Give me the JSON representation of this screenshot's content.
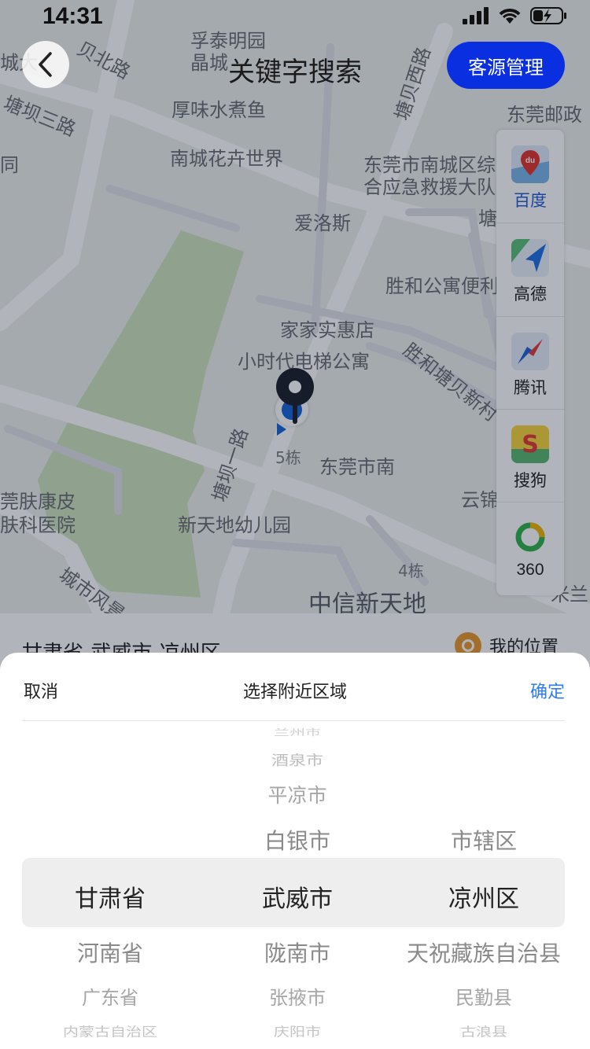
{
  "status_bar": {
    "time": "14:31"
  },
  "header": {
    "title": "关键字搜索",
    "source_button": "客源管理"
  },
  "map": {
    "labels": [
      "孚泰明园",
      "晶城",
      "城大",
      "贝北路",
      "塘贝西路",
      "塘坝三路",
      "厚味水煮鱼",
      "东莞邮政",
      "南城花卉世界",
      "东莞市南城区综",
      "合应急救援大队",
      "爱洛斯",
      "塘",
      "胜和公寓便利",
      "家家实惠店",
      "小时代电梯公寓",
      "胜和塘贝新村",
      "塘坝一路",
      "5栋",
      "东莞市南",
      "云锦",
      "莞肤康皮",
      "肤科医院",
      "新天地幼儿园",
      "城市风景",
      "4栋",
      "中信新天地",
      "米兰",
      "同"
    ]
  },
  "providers": [
    {
      "label": "百度",
      "icon": "baidu-map-icon",
      "active": true
    },
    {
      "label": "高德",
      "icon": "amap-icon"
    },
    {
      "label": "腾讯",
      "icon": "tencent-map-icon"
    },
    {
      "label": "搜狗",
      "icon": "sogou-map-icon"
    },
    {
      "label": "360",
      "icon": "360-map-icon"
    }
  ],
  "info_bar": {
    "region": "甘肃省-武威市-凉州区",
    "my_location": "我的位置"
  },
  "sheet": {
    "cancel": "取消",
    "title": "选择附近区域",
    "confirm": "确定",
    "accent": "#2f7bf2",
    "province": [
      "甘肃省",
      "河南省",
      "广东省",
      "内蒙古自治区"
    ],
    "city": [
      "兰州市",
      "酒泉市",
      "平凉市",
      "白银市",
      "武威市",
      "陇南市",
      "张掖市",
      "庆阳市"
    ],
    "district": [
      "市辖区",
      "凉州区",
      "天祝藏族自治县",
      "民勤县",
      "古浪县"
    ]
  }
}
